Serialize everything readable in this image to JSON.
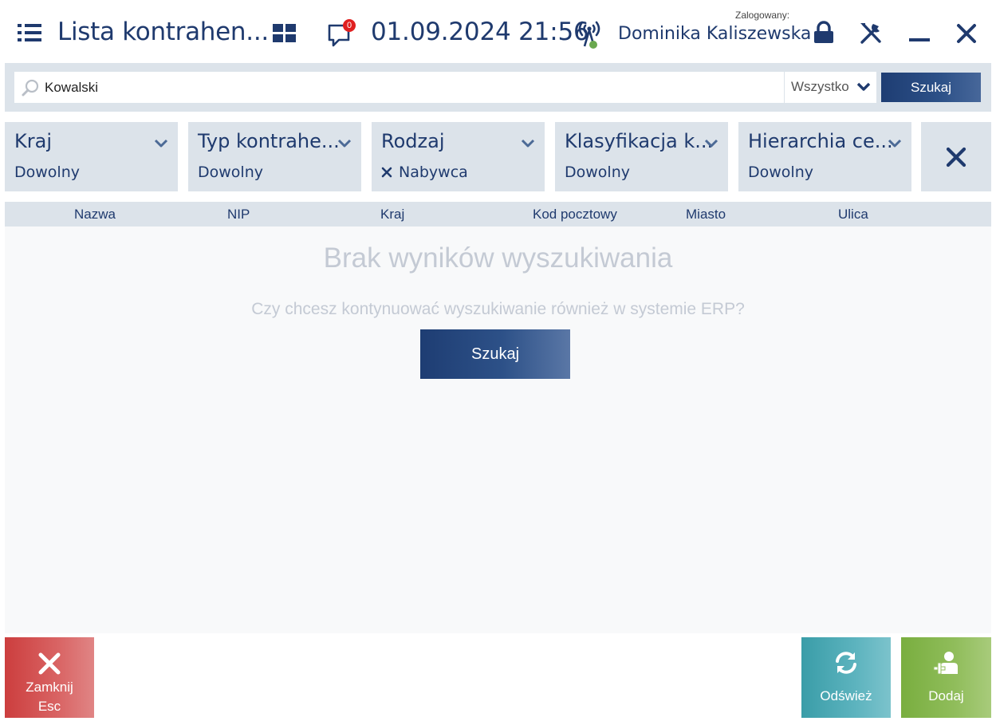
{
  "header": {
    "title": "Lista kontrahen...",
    "notifications_count": "0",
    "datetime": "01.09.2024 21:56",
    "logged_label": "Zalogowany:",
    "user_name": "Dominika Kaliszewska",
    "icons": [
      "menu-icon",
      "grid-icon",
      "chat-icon",
      "signal-icon",
      "lock-icon",
      "tools-icon",
      "minimize-icon",
      "close-icon"
    ]
  },
  "search": {
    "value": "Kowalski",
    "scope": "Wszystko",
    "button_label": "Szukaj"
  },
  "filters": [
    {
      "title": "Kraj",
      "value": "Dowolny",
      "removable": false
    },
    {
      "title": "Typ kontrahe...",
      "value": "Dowolny",
      "removable": false
    },
    {
      "title": "Rodzaj",
      "value": "Nabywca",
      "removable": true
    },
    {
      "title": "Klasyfikacja k...",
      "value": "Dowolny",
      "removable": false
    },
    {
      "title": "Hierarchia ce...",
      "value": "Dowolny",
      "removable": false
    }
  ],
  "table": {
    "columns": [
      "Nazwa",
      "NIP",
      "Kraj",
      "Kod pocztowy",
      "Miasto",
      "Ulica"
    ]
  },
  "empty_state": {
    "title": "Brak wyników wyszukiwania",
    "question": "Czy chcesz kontynuować wyszukiwanie również w systemie ERP?",
    "button_label": "Szukaj"
  },
  "footer": {
    "close_label": "Zamknij",
    "close_shortcut": "Esc",
    "refresh_label": "Odśwież",
    "add_label": "Dodaj"
  },
  "colors": {
    "primary": "#1f3a6e",
    "panel": "#dce3ea",
    "close": "#cc3e3e",
    "refresh": "#3a9da8",
    "add": "#79ae3f",
    "badge": "#e02020"
  }
}
